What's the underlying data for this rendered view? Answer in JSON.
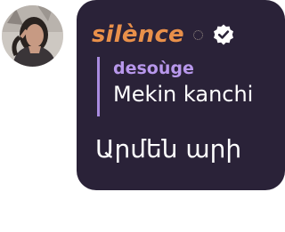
{
  "message": {
    "author": {
      "username": "silènce",
      "avatar_icon": "avatar",
      "status_icon": "dotted-circle-icon",
      "badge_icon": "verified-badge-icon",
      "username_color": "#e9904a"
    },
    "reply": {
      "author": "desoùge",
      "text": "Mekin kanchi",
      "accent_color": "#a98be0"
    },
    "text": "Արմեն արի",
    "bubble_color": "#2a2238"
  }
}
